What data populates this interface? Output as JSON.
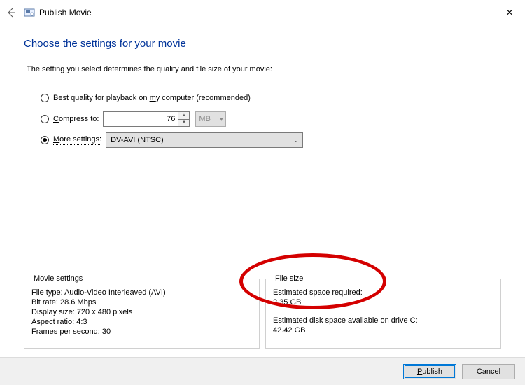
{
  "window": {
    "title": "Publish Movie",
    "close_symbol": "✕",
    "back_symbol": "←"
  },
  "heading": "Choose the settings for your movie",
  "intro": "The setting you select determines the quality and file size of your movie:",
  "options": {
    "best": {
      "prefix": "Best quality for playback on ",
      "hotkey": "m",
      "suffix": "y computer (recommended)"
    },
    "compress": {
      "hotkey": "C",
      "suffix": "ompress to:",
      "value": "76",
      "unit": "MB"
    },
    "more": {
      "hotkey": "M",
      "suffix": "ore settings:",
      "selected_value": "DV-AVI (NTSC)"
    },
    "selected": "more"
  },
  "movie_settings": {
    "legend": "Movie settings",
    "file_type_label": "File type:",
    "file_type_value": "Audio-Video Interleaved (AVI)",
    "bitrate_label": "Bit rate:",
    "bitrate_value": "28.6 Mbps",
    "display_label": "Display size:",
    "display_value": "720 x 480 pixels",
    "aspect_label": "Aspect ratio:",
    "aspect_value": "4:3",
    "fps_label": "Frames per second:",
    "fps_value": "30"
  },
  "file_size": {
    "legend": "File size",
    "est_req_label": "Estimated space required:",
    "est_req_value": "2.35 GB",
    "est_avail_label": "Estimated disk space available on drive C:",
    "est_avail_value": "42.42 GB"
  },
  "buttons": {
    "publish_hotkey": "P",
    "publish_suffix": "ublish",
    "cancel": "Cancel"
  }
}
